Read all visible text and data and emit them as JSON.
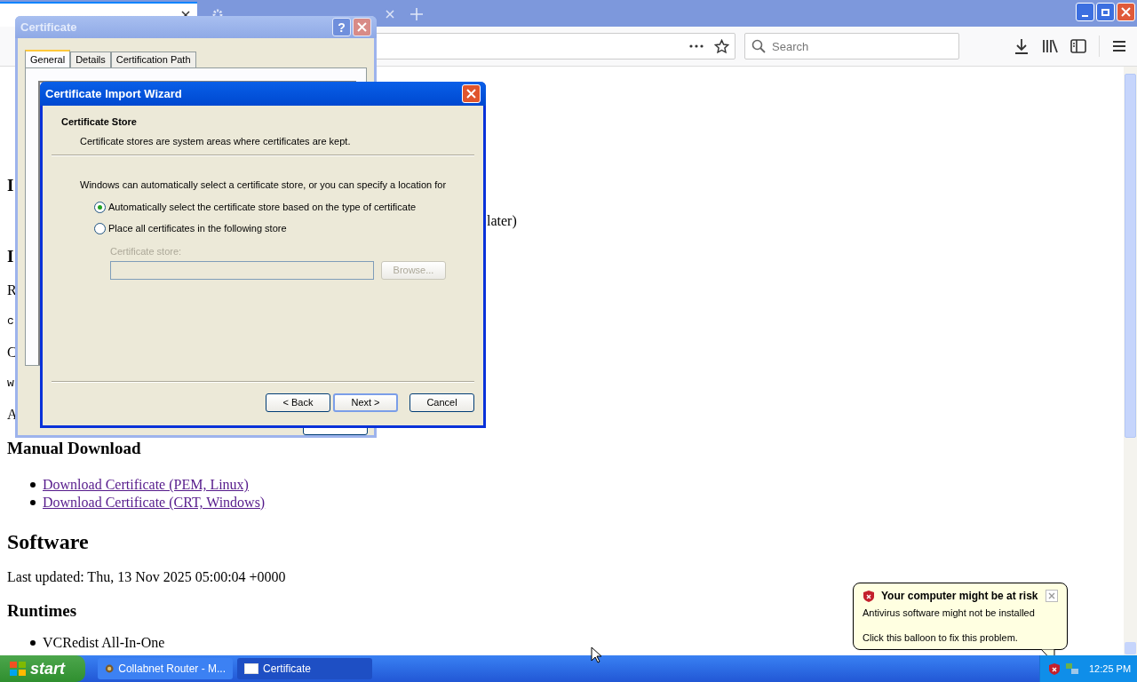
{
  "browser": {
    "tabs": [
      {
        "selected": true
      },
      {
        "selected": false
      }
    ],
    "search": {
      "placeholder": "Search"
    }
  },
  "page": {
    "blocks": [
      {
        "kind": "h3",
        "text": "I"
      },
      {
        "kind": "tail",
        "text": "later)"
      },
      {
        "kind": "h3",
        "text": "I"
      },
      {
        "kind": "p",
        "text": "R"
      },
      {
        "kind": "mono",
        "text": "c"
      },
      {
        "kind": "p",
        "text": "C"
      },
      {
        "kind": "mono",
        "text": "w"
      },
      {
        "kind": "p",
        "text": "A"
      },
      {
        "kind": "h3",
        "text": "Manual Download"
      },
      {
        "kind": "links",
        "items": [
          "Download Certificate (PEM, Linux)",
          "Download Certificate (CRT, Windows)"
        ]
      },
      {
        "kind": "h2",
        "text": "Software"
      },
      {
        "kind": "p",
        "text": "Last updated: Thu, 13 Nov 2025 05:00:04 +0000"
      },
      {
        "kind": "h3",
        "text": "Runtimes"
      },
      {
        "kind": "bullet",
        "text": "VCRedist All-In-One"
      }
    ]
  },
  "certificate_dialog": {
    "title": "Certificate",
    "help": "?",
    "tabs": [
      {
        "label": "General",
        "selected": true
      },
      {
        "label": "Details",
        "selected": false
      },
      {
        "label": "Certification Path",
        "selected": false
      }
    ]
  },
  "wizard": {
    "title": "Certificate Import Wizard",
    "heading": "Certificate Store",
    "subtitle": "Certificate stores are system areas where certificates are kept.",
    "intro": "Windows can automatically select a certificate store, or you can specify a location for",
    "options": [
      {
        "label": "Automatically select the certificate store based on the type of certificate",
        "selected": true
      },
      {
        "label": "Place all certificates in the following store",
        "selected": false
      }
    ],
    "store_label": "Certificate store:",
    "store_disabled": true,
    "browse": "Browse...",
    "buttons": [
      {
        "label": "< Back",
        "default": false
      },
      {
        "label": "Next >",
        "default": true
      },
      {
        "label": "Cancel",
        "default": false
      }
    ]
  },
  "balloon": {
    "title": "Your computer might be at risk",
    "lines": [
      "Antivirus software might not be installed",
      "Click this balloon to fix this problem."
    ]
  },
  "taskbar": {
    "start": "start",
    "tasks": [
      {
        "label": "Collabnet Router - M...",
        "selected": false,
        "kind": "browser"
      },
      {
        "label": "Certificate",
        "selected": true,
        "kind": "window"
      }
    ],
    "clock": "12:25 PM"
  }
}
